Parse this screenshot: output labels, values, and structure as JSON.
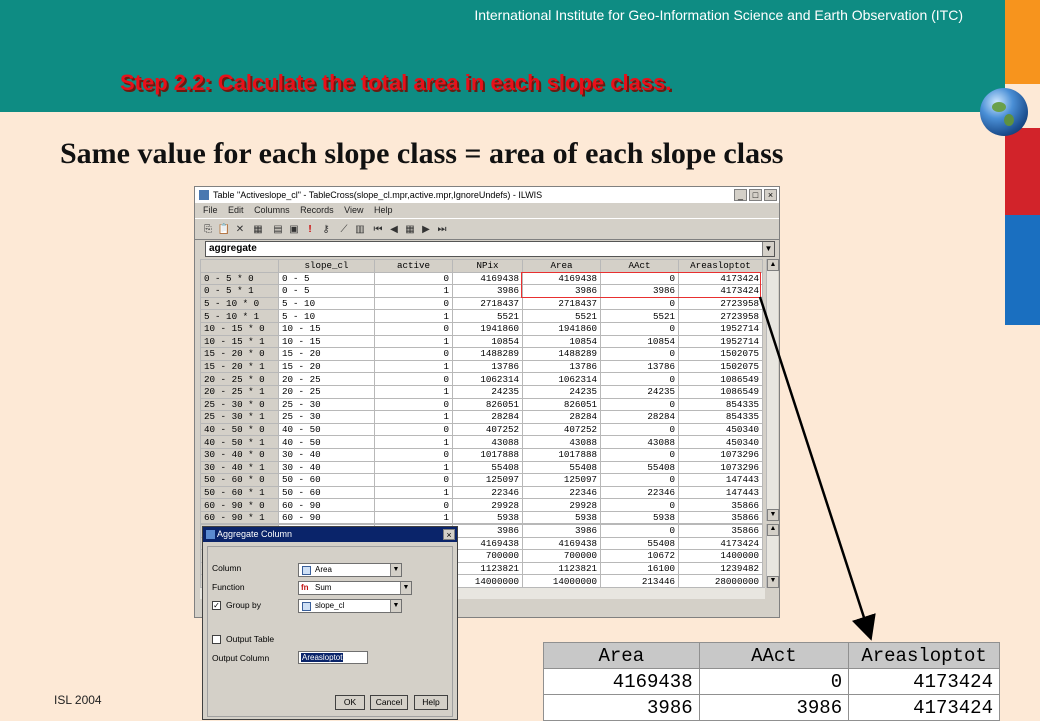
{
  "slide": {
    "institute": "International Institute for Geo-Information Science and Earth Observation (ITC)",
    "step_title": "Step 2.2: Calculate the total area in each slope class.",
    "subtitle": "Same value for each slope class = area of each slope class",
    "footer": "ISL 2004"
  },
  "window": {
    "title": "Table \"Activeslope_cl\" - TableCross(slope_cl.mpr,active.mpr,IgnoreUndefs) - ILWIS",
    "menu": [
      "File",
      "Edit",
      "Columns",
      "Records",
      "View",
      "Help"
    ],
    "command": "aggregate",
    "columns": [
      "slope_cl",
      "active",
      "NPix",
      "Area",
      "AAct",
      "Areasloptot"
    ],
    "rows": [
      [
        "0 - 5 * 0",
        "0 - 5",
        "0",
        "4169438",
        "4169438",
        "0",
        "4173424"
      ],
      [
        "0 - 5 * 1",
        "0 - 5",
        "1",
        "3986",
        "3986",
        "3986",
        "4173424"
      ],
      [
        "5 - 10 * 0",
        "5 - 10",
        "0",
        "2718437",
        "2718437",
        "0",
        "2723958"
      ],
      [
        "5 - 10 * 1",
        "5 - 10",
        "1",
        "5521",
        "5521",
        "5521",
        "2723958"
      ],
      [
        "10 - 15 * 0",
        "10 - 15",
        "0",
        "1941860",
        "1941860",
        "0",
        "1952714"
      ],
      [
        "10 - 15 * 1",
        "10 - 15",
        "1",
        "10854",
        "10854",
        "10854",
        "1952714"
      ],
      [
        "15 - 20 * 0",
        "15 - 20",
        "0",
        "1488289",
        "1488289",
        "0",
        "1502075"
      ],
      [
        "15 - 20 * 1",
        "15 - 20",
        "1",
        "13786",
        "13786",
        "13786",
        "1502075"
      ],
      [
        "20 - 25 * 0",
        "20 - 25",
        "0",
        "1062314",
        "1062314",
        "0",
        "1086549"
      ],
      [
        "20 - 25 * 1",
        "20 - 25",
        "1",
        "24235",
        "24235",
        "24235",
        "1086549"
      ],
      [
        "25 - 30 * 0",
        "25 - 30",
        "0",
        "826051",
        "826051",
        "0",
        "854335"
      ],
      [
        "25 - 30 * 1",
        "25 - 30",
        "1",
        "28284",
        "28284",
        "28284",
        "854335"
      ],
      [
        "40 - 50 * 0",
        "40 - 50",
        "0",
        "407252",
        "407252",
        "0",
        "450340"
      ],
      [
        "40 - 50 * 1",
        "40 - 50",
        "1",
        "43088",
        "43088",
        "43088",
        "450340"
      ],
      [
        "30 - 40 * 0",
        "30 - 40",
        "0",
        "1017888",
        "1017888",
        "0",
        "1073296"
      ],
      [
        "30 - 40 * 1",
        "30 - 40",
        "1",
        "55408",
        "55408",
        "55408",
        "1073296"
      ],
      [
        "50 - 60 * 0",
        "50 - 60",
        "0",
        "125097",
        "125097",
        "0",
        "147443"
      ],
      [
        "50 - 60 * 1",
        "50 - 60",
        "1",
        "22346",
        "22346",
        "22346",
        "147443"
      ],
      [
        "60 - 90 * 0",
        "60 - 90",
        "0",
        "29928",
        "29928",
        "0",
        "35866"
      ],
      [
        "60 - 90 * 1",
        "60 - 90",
        "1",
        "5938",
        "5938",
        "5938",
        "35866"
      ]
    ],
    "summary": [
      [
        "3986",
        "3986",
        "0",
        "35866"
      ],
      [
        "4169438",
        "4169438",
        "55408",
        "4173424"
      ],
      [
        "700000",
        "700000",
        "10672",
        "1400000"
      ],
      [
        "1123821",
        "1123821",
        "16100",
        "1239482"
      ],
      [
        "14000000",
        "14000000",
        "213446",
        "28000000"
      ]
    ]
  },
  "dialog": {
    "title": "Aggregate Column",
    "column_label": "Column",
    "column_value": "Area",
    "function_label": "Function",
    "function_value": "Sum",
    "function_icon": "fn",
    "groupby_label": "Group by",
    "groupby_value": "slope_cl",
    "groupby_checked": true,
    "output_table_label": "Output Table",
    "output_table_checked": false,
    "output_column_label": "Output Column",
    "output_column_value": "Areasloptot",
    "ok": "OK",
    "cancel": "Cancel",
    "help": "Help"
  },
  "zoom_table": {
    "headers": [
      "Area",
      "AAct",
      "Areasloptot"
    ],
    "rows": [
      [
        "4169438",
        "0",
        "4173424"
      ],
      [
        "3986",
        "3986",
        "4173424"
      ]
    ]
  },
  "colors": {
    "header_bg": "#0e8c83",
    "step_title": "#e8101a",
    "slide_bg": "#fde9d6"
  }
}
